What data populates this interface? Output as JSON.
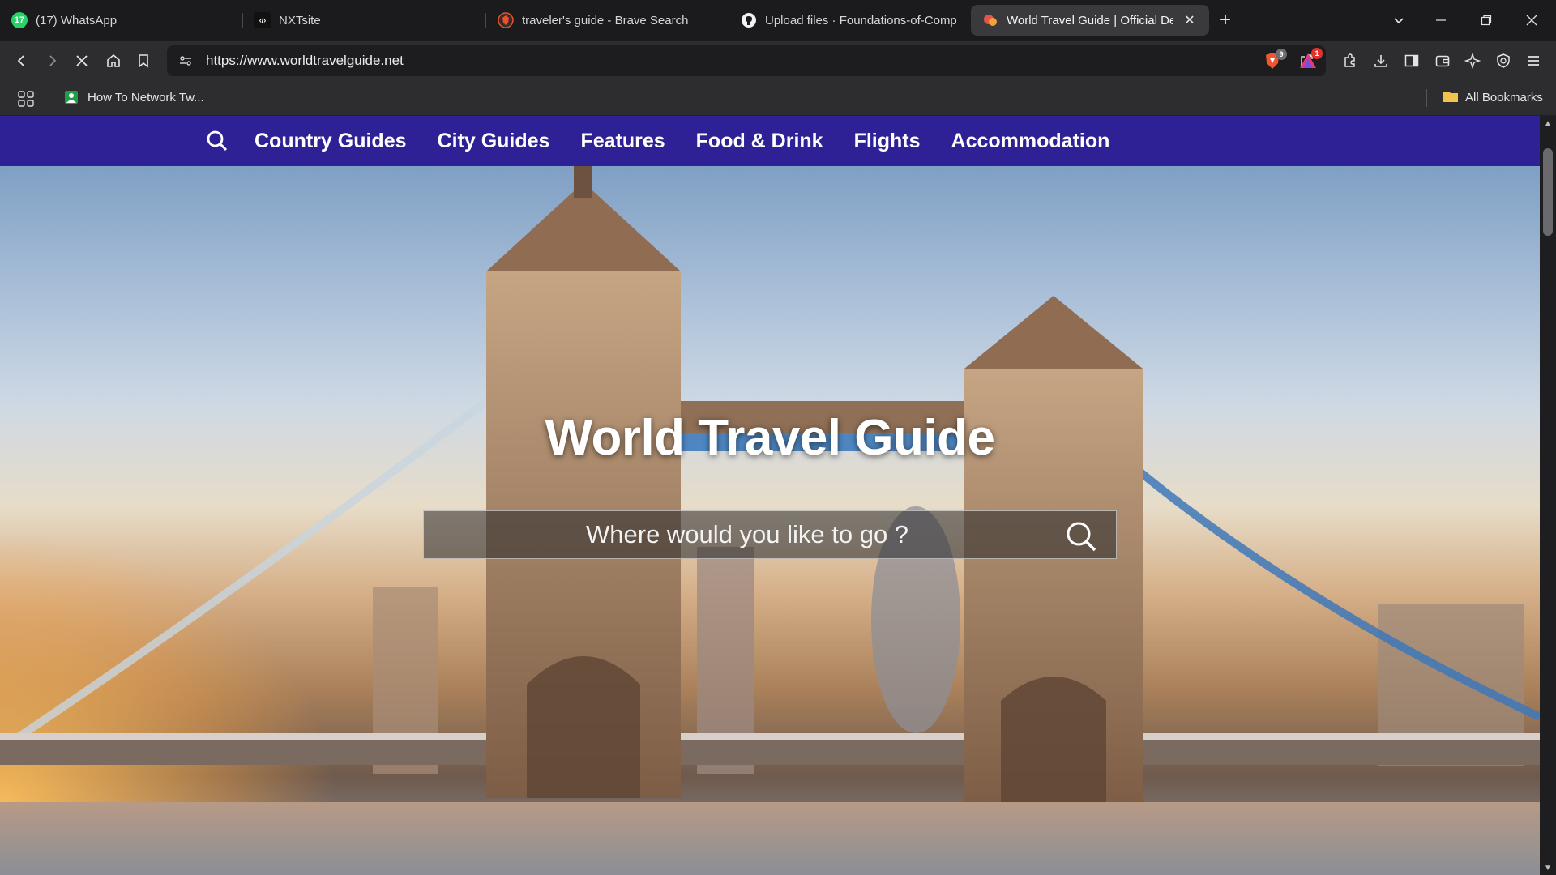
{
  "browser": {
    "tabs": [
      {
        "title": "(17) WhatsApp",
        "icon": "whatsapp-icon",
        "icon_text": "17",
        "icon_color": "#25d366",
        "active": false
      },
      {
        "title": "NXTsite",
        "icon": "nxtsite-icon",
        "icon_text": "‹/›",
        "icon_color": "#111111",
        "active": false
      },
      {
        "title": "traveler's guide - Brave Search",
        "icon": "brave-search-icon",
        "icon_text": "",
        "icon_color": "#e7532b",
        "active": false
      },
      {
        "title": "Upload files · Foundations-of-Comp",
        "icon": "github-icon",
        "icon_text": "",
        "icon_color": "#ffffff",
        "active": false
      },
      {
        "title": "World Travel Guide | Official De",
        "icon": "world-travel-guide-icon",
        "icon_text": "",
        "icon_color": "#e8524a",
        "active": true
      }
    ],
    "url": "https://www.worldtravelguide.net",
    "shields_count": "9",
    "rewards_count": "1",
    "bookmarks": [
      {
        "label": "How To Network Tw...",
        "icon": "bookmark-person-icon"
      }
    ],
    "all_bookmarks_label": "All Bookmarks"
  },
  "site": {
    "nav": {
      "items": [
        "Country Guides",
        "City Guides",
        "Features",
        "Food & Drink",
        "Flights",
        "Accommodation"
      ],
      "bg_color": "#2e2196"
    },
    "hero": {
      "title": "World Travel Guide",
      "search_placeholder": "Where would you like to go ?"
    }
  }
}
